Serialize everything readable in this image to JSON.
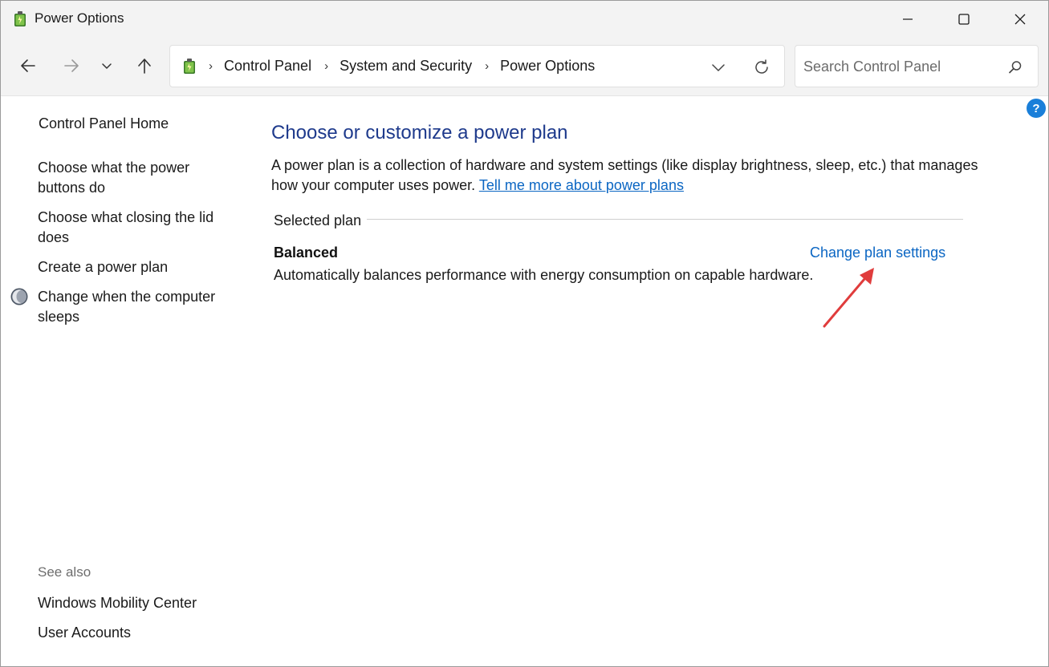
{
  "window": {
    "title": "Power Options"
  },
  "navigation": {
    "breadcrumbs": [
      "Control Panel",
      "System and Security",
      "Power Options"
    ],
    "search": {
      "placeholder": "Search Control Panel",
      "value": ""
    }
  },
  "sidebar": {
    "home": "Control Panel Home",
    "links": [
      "Choose what the power buttons do",
      "Choose what closing the lid does",
      "Create a power plan",
      "Change when the computer sleeps"
    ],
    "see_also_label": "See also",
    "see_also_links": [
      "Windows Mobility Center",
      "User Accounts"
    ]
  },
  "main": {
    "title": "Choose or customize a power plan",
    "description": "A power plan is a collection of hardware and system settings (like display brightness, sleep, etc.) that manages how your computer uses power.",
    "description_link": "Tell me more about power plans",
    "section_label": "Selected plan",
    "plan": {
      "name": "Balanced",
      "description": "Automatically balances performance with energy consumption on capable hardware.",
      "settings_link": "Change plan settings"
    }
  },
  "colors": {
    "title_blue": "#1e3a8c",
    "link_blue": "#0b66c3",
    "annotation_arrow": "#e03c3c",
    "help_blue": "#1a7fd9"
  },
  "icons": {
    "app": "power-options-icon",
    "help": "help-icon"
  }
}
